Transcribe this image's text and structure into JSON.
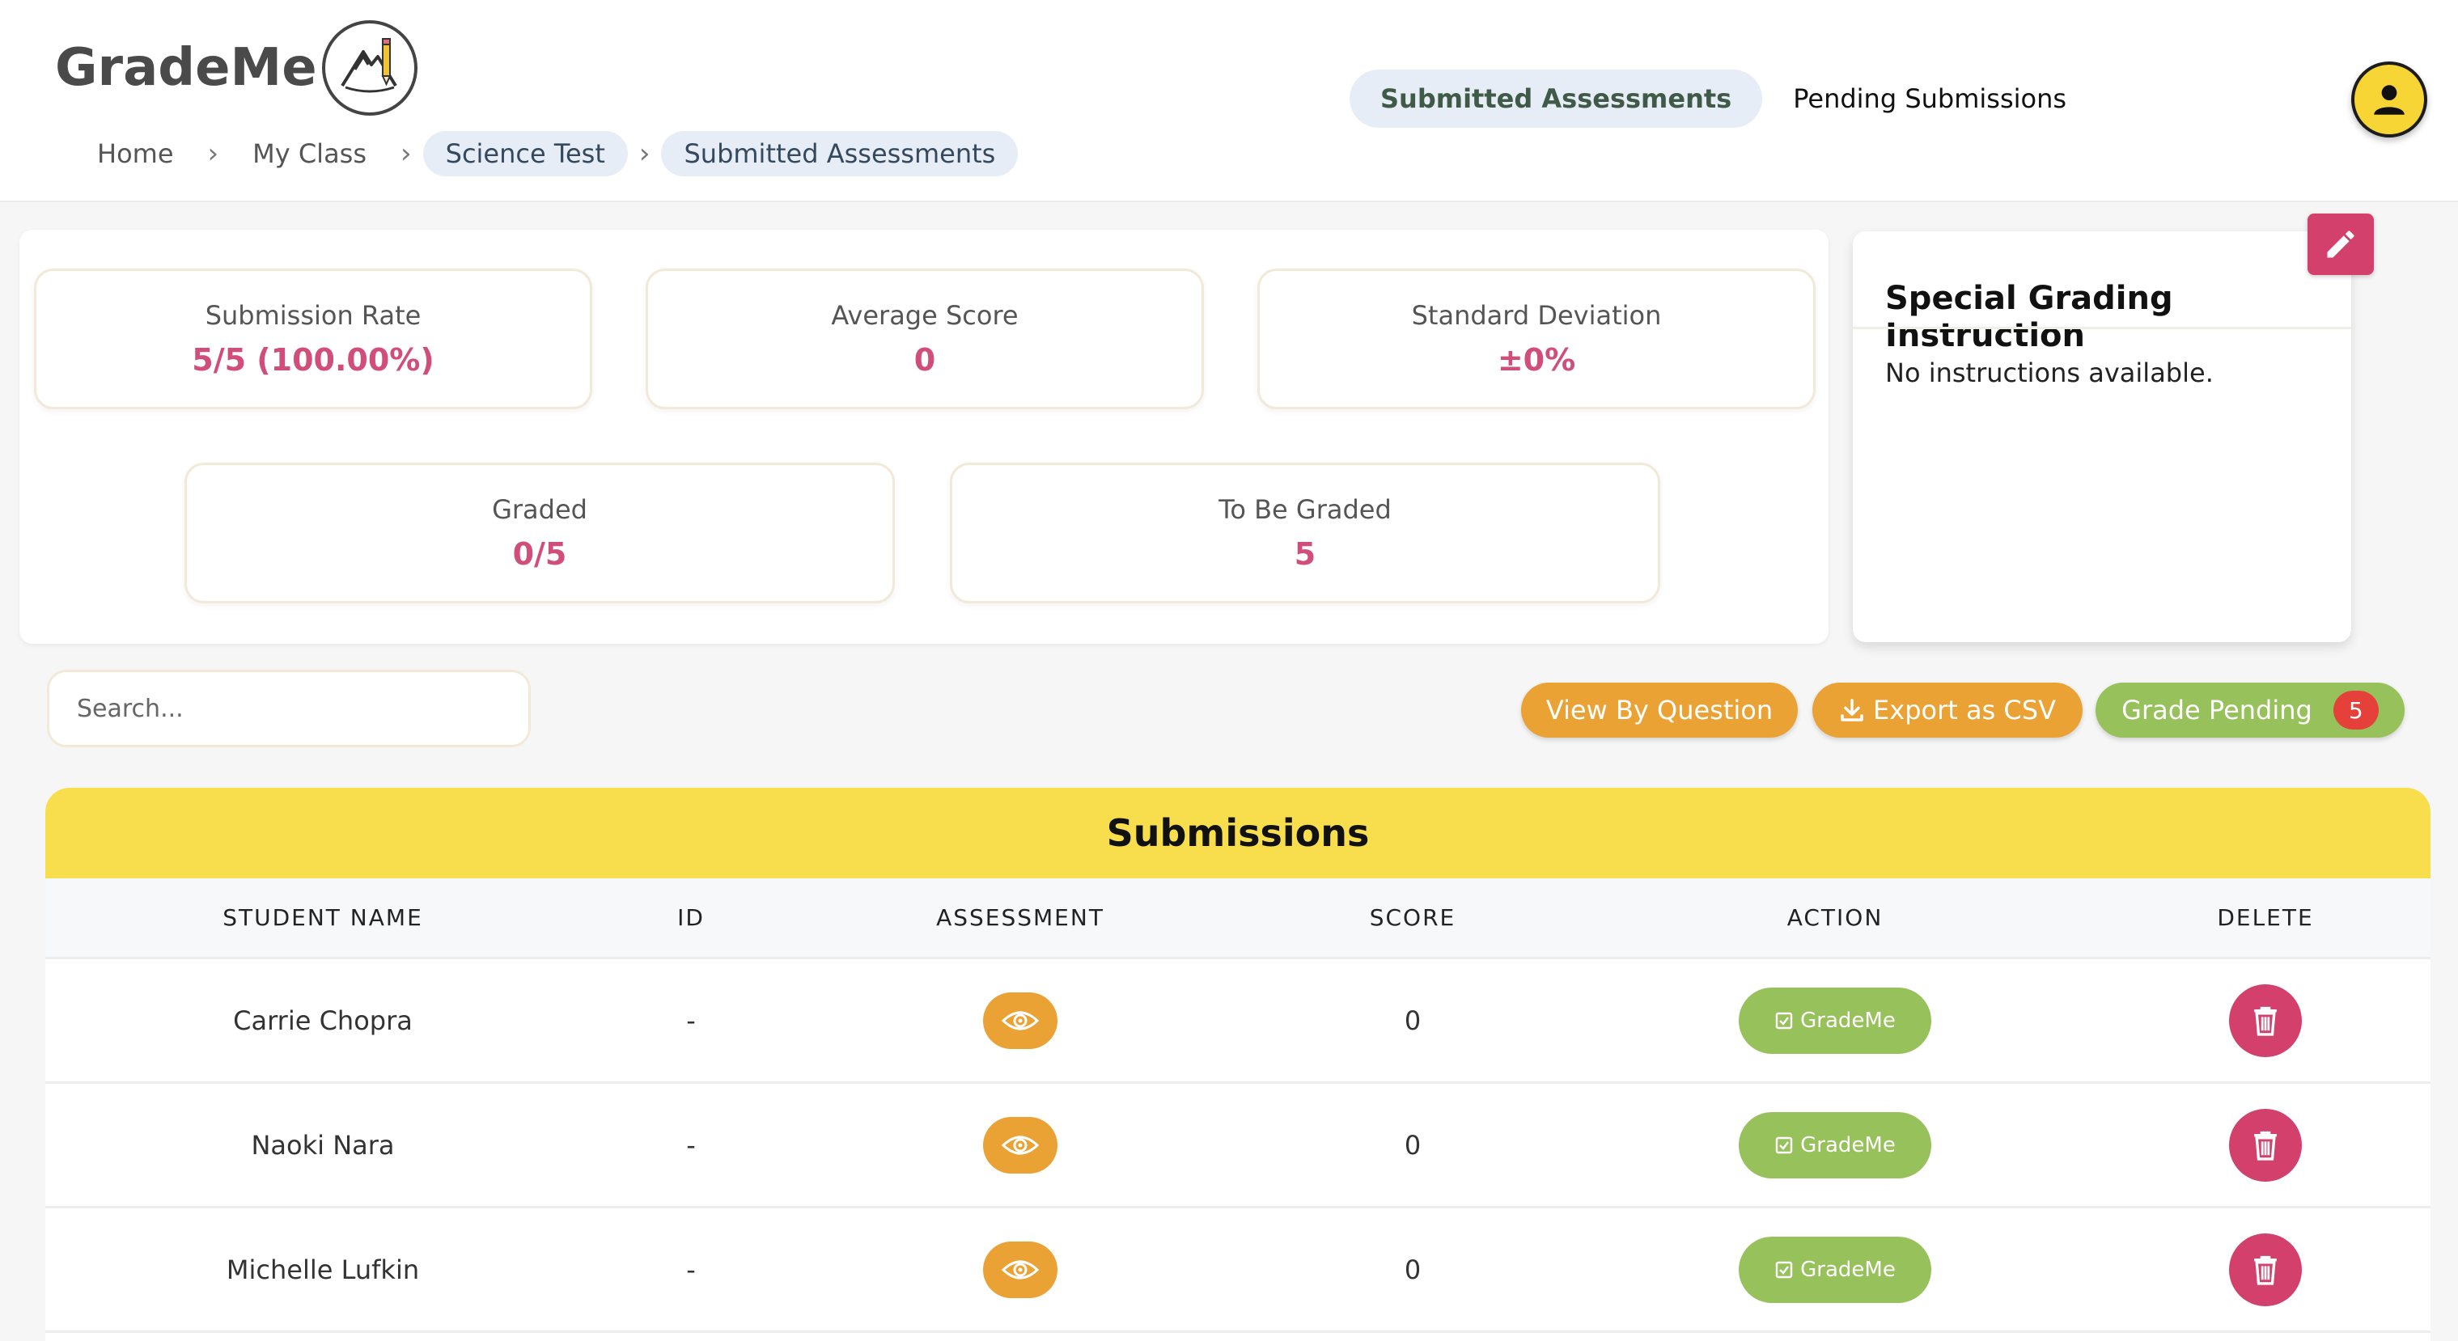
{
  "app": {
    "logo_text": "GradeMe"
  },
  "breadcrumb": {
    "items": [
      "Home",
      "My Class",
      "Science Test",
      "Submitted Assessments"
    ]
  },
  "nav": {
    "tabs": [
      {
        "label": "Submitted Assessments",
        "active": true
      },
      {
        "label": "Pending Submissions",
        "active": false
      }
    ]
  },
  "stats": {
    "submission_rate": {
      "label": "Submission Rate",
      "value": "5/5 (100.00%)"
    },
    "average_score": {
      "label": "Average Score",
      "value": "0"
    },
    "standard_deviation": {
      "label": "Standard Deviation",
      "value": "±0%"
    },
    "graded": {
      "label": "Graded",
      "value": "0/5"
    },
    "to_be_graded": {
      "label": "To Be Graded",
      "value": "5"
    }
  },
  "instructions": {
    "title": "Special Grading Instruction",
    "text": "No instructions available."
  },
  "toolbar": {
    "search_placeholder": "Search...",
    "view_by_question": "View By Question",
    "export_csv": "Export as CSV",
    "grade_pending": "Grade Pending",
    "pending_count": "5"
  },
  "table": {
    "title": "Submissions",
    "headers": [
      "STUDENT NAME",
      "ID",
      "ASSESSMENT",
      "SCORE",
      "ACTION",
      "DELETE"
    ],
    "action_label": "GradeMe",
    "rows": [
      {
        "name": "Carrie Chopra",
        "id": "-",
        "score": "0"
      },
      {
        "name": "Naoki Nara",
        "id": "-",
        "score": "0"
      },
      {
        "name": "Michelle Lufkin",
        "id": "-",
        "score": "0"
      }
    ]
  },
  "colors": {
    "accent_pink": "#d14d7a",
    "orange": "#eba234",
    "green": "#97c15a",
    "yellow": "#f8de4c",
    "delete_red": "#d2406b"
  },
  "icons": {
    "logo_badge": "pencil-mountain-icon",
    "avatar": "user-icon",
    "edit": "pencil-icon",
    "export": "download-icon",
    "view": "eye-icon",
    "action": "checkbox-icon",
    "delete": "trash-icon",
    "separator": "chevron-right-icon"
  }
}
